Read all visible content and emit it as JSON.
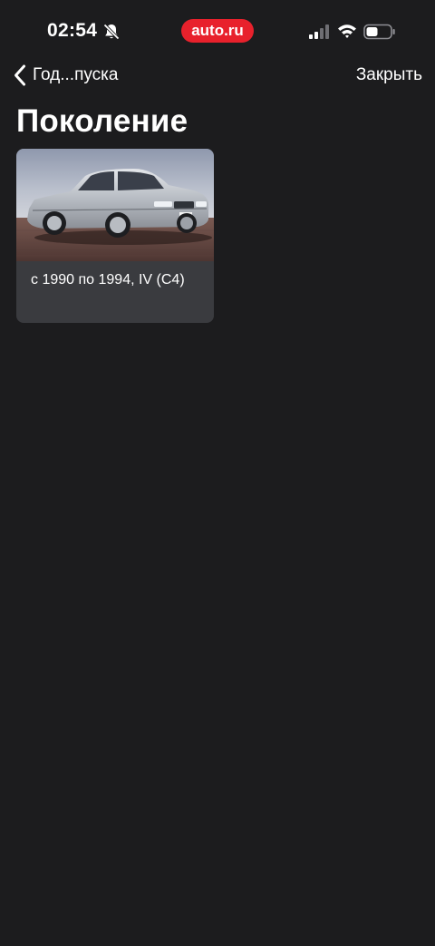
{
  "status_bar": {
    "time": "02:54",
    "app_badge": "auto.ru",
    "icons": [
      "bell-slash-icon",
      "cellular-signal-icon",
      "wifi-icon",
      "battery-icon"
    ]
  },
  "nav": {
    "back_label": "Год...пуска",
    "close_label": "Закрыть"
  },
  "page": {
    "title": "Поколение"
  },
  "generations": [
    {
      "label": "с 1990 по 1994, IV (C4)",
      "image": "car-photo"
    }
  ],
  "colors": {
    "background": "#1c1c1e",
    "card": "#3a3b3f",
    "badge": "#e8212c",
    "text": "#ffffff"
  }
}
